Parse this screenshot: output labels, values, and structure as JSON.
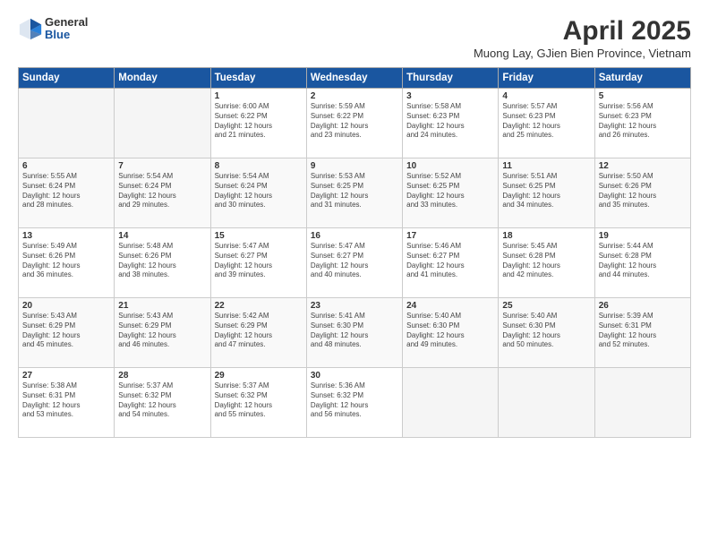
{
  "header": {
    "logo": {
      "general": "General",
      "blue": "Blue"
    },
    "title": "April 2025",
    "subtitle": "Muong Lay, GJien Bien Province, Vietnam"
  },
  "weekdays": [
    "Sunday",
    "Monday",
    "Tuesday",
    "Wednesday",
    "Thursday",
    "Friday",
    "Saturday"
  ],
  "weeks": [
    [
      {
        "day": "",
        "details": ""
      },
      {
        "day": "",
        "details": ""
      },
      {
        "day": "1",
        "details": "Sunrise: 6:00 AM\nSunset: 6:22 PM\nDaylight: 12 hours\nand 21 minutes."
      },
      {
        "day": "2",
        "details": "Sunrise: 5:59 AM\nSunset: 6:22 PM\nDaylight: 12 hours\nand 23 minutes."
      },
      {
        "day": "3",
        "details": "Sunrise: 5:58 AM\nSunset: 6:23 PM\nDaylight: 12 hours\nand 24 minutes."
      },
      {
        "day": "4",
        "details": "Sunrise: 5:57 AM\nSunset: 6:23 PM\nDaylight: 12 hours\nand 25 minutes."
      },
      {
        "day": "5",
        "details": "Sunrise: 5:56 AM\nSunset: 6:23 PM\nDaylight: 12 hours\nand 26 minutes."
      }
    ],
    [
      {
        "day": "6",
        "details": "Sunrise: 5:55 AM\nSunset: 6:24 PM\nDaylight: 12 hours\nand 28 minutes."
      },
      {
        "day": "7",
        "details": "Sunrise: 5:54 AM\nSunset: 6:24 PM\nDaylight: 12 hours\nand 29 minutes."
      },
      {
        "day": "8",
        "details": "Sunrise: 5:54 AM\nSunset: 6:24 PM\nDaylight: 12 hours\nand 30 minutes."
      },
      {
        "day": "9",
        "details": "Sunrise: 5:53 AM\nSunset: 6:25 PM\nDaylight: 12 hours\nand 31 minutes."
      },
      {
        "day": "10",
        "details": "Sunrise: 5:52 AM\nSunset: 6:25 PM\nDaylight: 12 hours\nand 33 minutes."
      },
      {
        "day": "11",
        "details": "Sunrise: 5:51 AM\nSunset: 6:25 PM\nDaylight: 12 hours\nand 34 minutes."
      },
      {
        "day": "12",
        "details": "Sunrise: 5:50 AM\nSunset: 6:26 PM\nDaylight: 12 hours\nand 35 minutes."
      }
    ],
    [
      {
        "day": "13",
        "details": "Sunrise: 5:49 AM\nSunset: 6:26 PM\nDaylight: 12 hours\nand 36 minutes."
      },
      {
        "day": "14",
        "details": "Sunrise: 5:48 AM\nSunset: 6:26 PM\nDaylight: 12 hours\nand 38 minutes."
      },
      {
        "day": "15",
        "details": "Sunrise: 5:47 AM\nSunset: 6:27 PM\nDaylight: 12 hours\nand 39 minutes."
      },
      {
        "day": "16",
        "details": "Sunrise: 5:47 AM\nSunset: 6:27 PM\nDaylight: 12 hours\nand 40 minutes."
      },
      {
        "day": "17",
        "details": "Sunrise: 5:46 AM\nSunset: 6:27 PM\nDaylight: 12 hours\nand 41 minutes."
      },
      {
        "day": "18",
        "details": "Sunrise: 5:45 AM\nSunset: 6:28 PM\nDaylight: 12 hours\nand 42 minutes."
      },
      {
        "day": "19",
        "details": "Sunrise: 5:44 AM\nSunset: 6:28 PM\nDaylight: 12 hours\nand 44 minutes."
      }
    ],
    [
      {
        "day": "20",
        "details": "Sunrise: 5:43 AM\nSunset: 6:29 PM\nDaylight: 12 hours\nand 45 minutes."
      },
      {
        "day": "21",
        "details": "Sunrise: 5:43 AM\nSunset: 6:29 PM\nDaylight: 12 hours\nand 46 minutes."
      },
      {
        "day": "22",
        "details": "Sunrise: 5:42 AM\nSunset: 6:29 PM\nDaylight: 12 hours\nand 47 minutes."
      },
      {
        "day": "23",
        "details": "Sunrise: 5:41 AM\nSunset: 6:30 PM\nDaylight: 12 hours\nand 48 minutes."
      },
      {
        "day": "24",
        "details": "Sunrise: 5:40 AM\nSunset: 6:30 PM\nDaylight: 12 hours\nand 49 minutes."
      },
      {
        "day": "25",
        "details": "Sunrise: 5:40 AM\nSunset: 6:30 PM\nDaylight: 12 hours\nand 50 minutes."
      },
      {
        "day": "26",
        "details": "Sunrise: 5:39 AM\nSunset: 6:31 PM\nDaylight: 12 hours\nand 52 minutes."
      }
    ],
    [
      {
        "day": "27",
        "details": "Sunrise: 5:38 AM\nSunset: 6:31 PM\nDaylight: 12 hours\nand 53 minutes."
      },
      {
        "day": "28",
        "details": "Sunrise: 5:37 AM\nSunset: 6:32 PM\nDaylight: 12 hours\nand 54 minutes."
      },
      {
        "day": "29",
        "details": "Sunrise: 5:37 AM\nSunset: 6:32 PM\nDaylight: 12 hours\nand 55 minutes."
      },
      {
        "day": "30",
        "details": "Sunrise: 5:36 AM\nSunset: 6:32 PM\nDaylight: 12 hours\nand 56 minutes."
      },
      {
        "day": "",
        "details": ""
      },
      {
        "day": "",
        "details": ""
      },
      {
        "day": "",
        "details": ""
      }
    ]
  ]
}
